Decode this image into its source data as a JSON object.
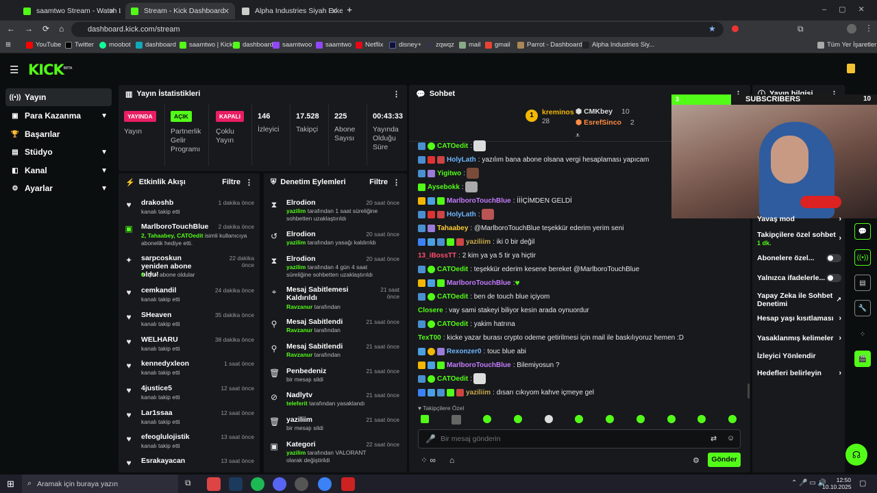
{
  "tabs": [
    {
      "label": "saamtwo Stream - Watch Live o"
    },
    {
      "label": "Stream - Kick Dashboard"
    },
    {
      "label": "Alpha Industries Siyah Erkek Si"
    }
  ],
  "url": "dashboard.kick.com/stream",
  "bookmarks": [
    "YouTube",
    "Twitter",
    "moobot",
    "dashboard",
    "saamtwo | Kick",
    "dashboard",
    "saamtwoo",
    "saamtwo",
    "Netflix",
    "disney+",
    "zqwqz",
    "mail",
    "gmail",
    "Parrot - Dashboard",
    "Alpha Industries Siy...",
    "Tüm Yer İşaretleri"
  ],
  "brand": {
    "logo": "KICK",
    "beta": "BETA"
  },
  "sidebar": [
    {
      "label": "Yayın"
    },
    {
      "label": "Para Kazanma"
    },
    {
      "label": "Başarılar"
    },
    {
      "label": "Stüdyo"
    },
    {
      "label": "Kanal"
    },
    {
      "label": "Ayarlar"
    }
  ],
  "stats": {
    "title": "Yayın İstatistikleri",
    "items": [
      {
        "badge": "YAYINDA",
        "label": "Yayın"
      },
      {
        "badge": "AÇIK",
        "label": "Partnerlik Gelir Programı"
      },
      {
        "badge": "KAPALI",
        "label": "Çoklu Yayın"
      },
      {
        "value": "146",
        "label": "İzleyici"
      },
      {
        "value": "17.528",
        "label": "Takipçi"
      },
      {
        "value": "225",
        "label": "Abone Sayısı"
      },
      {
        "value": "00:43:33",
        "label": "Yayında Olduğu Süre"
      }
    ]
  },
  "activity": {
    "title": "Etkinlik Akışı",
    "filter": "Filtre",
    "items": [
      {
        "name": "drakoshb",
        "sub": "kanalı takip etti",
        "time": "1 dakika önce"
      },
      {
        "name": "MarlboroTouchBlue",
        "sub_hl": "2, Tahaabey, CATOedit",
        "sub": " isimli kullanıcıya abonelik hediye etti.",
        "time": "2 dakika önce"
      },
      {
        "name": "sarpcoskun yeniden abone oldu!",
        "sub_hl": "6",
        "sub": " aylık abone oldular",
        "time": "22 dakika önce"
      },
      {
        "name": "cemkandil",
        "sub": "kanalı takip etti",
        "time": "24 dakika önce"
      },
      {
        "name": "SHeaven",
        "sub": "kanalı takip etti",
        "time": "35 dakika önce"
      },
      {
        "name": "WELHARU",
        "sub": "kanalı takip etti",
        "time": "38 dakika önce"
      },
      {
        "name": "kennedyxleon",
        "sub": "kanalı takip etti",
        "time": "1 saat önce"
      },
      {
        "name": "4justice5",
        "sub": "kanalı takip etti",
        "time": "12 saat önce"
      },
      {
        "name": "Lar1ssaa",
        "sub": "kanalı takip etti",
        "time": "12 saat önce"
      },
      {
        "name": "efeoglulojistik",
        "sub": "kanalı takip etti",
        "time": "13 saat önce"
      },
      {
        "name": "Esrakayacan",
        "sub": "",
        "time": "13 saat önce"
      }
    ]
  },
  "moderation": {
    "title": "Denetim Eylemleri",
    "filter": "Filtre",
    "items": [
      {
        "name": "Elrodion",
        "hl": "yazilim",
        "sub": " tarafından 1 saat süreliğine sohbetten uzaklaştırıldı",
        "time": "20 saat önce"
      },
      {
        "name": "Elrodion",
        "hl": "yazilim",
        "sub": " tarafından yasağı kaldırıldı",
        "time": "20 saat önce"
      },
      {
        "name": "Elrodion",
        "hl": "yazilim",
        "sub": " tarafından 4 gün 4 saat süreliğine sohbetten uzaklaştırıldı",
        "time": "20 saat önce"
      },
      {
        "name": "Mesaj Sabitlemesi Kaldırıldı",
        "hl": "Ravzanur",
        "sub": " tarafından",
        "time": "21 saat önce"
      },
      {
        "name": "Mesaj Sabitlendi",
        "hl": "Ravzanur",
        "sub": " tarafından",
        "time": "21 saat önce"
      },
      {
        "name": "Mesaj Sabitlendi",
        "hl": "Ravzanur",
        "sub": " tarafından",
        "time": "21 saat önce"
      },
      {
        "name": "Penbedeniz",
        "hl": "",
        "sub": "bir mesajı sildi",
        "time": "21 saat önce"
      },
      {
        "name": "Nadlytv",
        "hl": "teleferit",
        "sub": " tarafından yasaklandı",
        "time": "21 saat önce"
      },
      {
        "name": "yaziliim",
        "hl": "",
        "sub": "bir mesajı sildi",
        "time": "21 saat önce"
      },
      {
        "name": "Kategori",
        "hl": "yazilim",
        "sub": " tarafından VALORANT olarak değiştirildi",
        "time": "22 saat önce"
      }
    ]
  },
  "chat": {
    "title": "Sohbet",
    "top": [
      {
        "rank": "1",
        "name": "kreminos",
        "count": "28"
      },
      {
        "name": "CMKbey",
        "count": "10"
      },
      {
        "name": "EsrefSinco",
        "count": "2"
      }
    ],
    "messages": [
      {
        "user": "CATOedit",
        "color": "#53fc18",
        "text": ""
      },
      {
        "user": "HolyLath",
        "color": "#6fb7ff",
        "text": "yazılım bana abone olsana vergi hesaplaması yapıcam"
      },
      {
        "user": "Yigitwo",
        "color": "#53fc18",
        "text": ""
      },
      {
        "user": "Aysebokk",
        "color": "#53fc18",
        "text": ""
      },
      {
        "user": "MarlboroTouchBlue",
        "color": "#c67cff",
        "text": "İİİÇİMDEN GELDİ"
      },
      {
        "user": "HolyLath",
        "color": "#6fb7ff",
        "text": ""
      },
      {
        "user": "Tahaabey",
        "color": "#ffcc33",
        "text": "@MarlboroTouchBlue teşekkür ederim yerim seni"
      },
      {
        "user": "yaziliim",
        "color": "#c9a84a",
        "text": "iki 0 bir değil"
      },
      {
        "user": "13_iBossTT",
        "color": "#ff4d6d",
        "text": "2 kim ya ya 5 tir ya hiçtir"
      },
      {
        "user": "CATOedit",
        "color": "#53fc18",
        "text": "teşekkür ederim kesene bereket @MarlboroTouchBlue"
      },
      {
        "user": "MarlboroTouchBlue",
        "color": "#c67cff",
        "text": ""
      },
      {
        "user": "CATOedit",
        "color": "#53fc18",
        "text": "ben de touch blue içiyom"
      },
      {
        "user": "Closere",
        "color": "#53fc18",
        "text": "vay sami stakeyi biliyor kesin arada oynuordur"
      },
      {
        "user": "CATOedit",
        "color": "#53fc18",
        "text": "yakim hatrına"
      },
      {
        "user": "TexT00",
        "color": "#53fc18",
        "text": "kicke yazar burası crypto odeme getirilmesi için mail ile baskılıyoruz hemen :D"
      },
      {
        "user": "Rexonzer0",
        "color": "#6fb7ff",
        "text": "touc blue abi"
      },
      {
        "user": "MarlboroTouchBlue",
        "color": "#c67cff",
        "text": "Bilemiyosun ?"
      },
      {
        "user": "CATOedit",
        "color": "#53fc18",
        "text": ""
      },
      {
        "user": "yaziliim",
        "color": "#c9a84a",
        "text": "dısarı cıkıyom kahve içmeye gel"
      }
    ],
    "emote_label": "Takipçilere Özel",
    "placeholder": "Bir mesaj gönderin",
    "send": "Gönder"
  },
  "info": {
    "title": "Yayın bilgisi",
    "overlay_count": "3",
    "overlay_label": "SUBSCRIBERS",
    "overlay_goal": "10",
    "settings": [
      {
        "label": "Yavaş mod"
      },
      {
        "label": "Takipçilere özel sohbet",
        "sub": "1 dk."
      },
      {
        "label": "Abonelere özel..."
      },
      {
        "label": "Yalnızca ifadelerle..."
      },
      {
        "label": "Yapay Zeka ile Sohbet Denetimi"
      },
      {
        "label": "Hesap yaşı kısıtlaması"
      },
      {
        "label": "Yasaklanmış kelimeler"
      },
      {
        "label": "İzleyici Yönlendir"
      },
      {
        "label": "Hedefleri belirleyin"
      }
    ]
  },
  "taskbar": {
    "search": "Aramak için buraya yazın",
    "time": "12:50",
    "date": "10.10.2025"
  }
}
